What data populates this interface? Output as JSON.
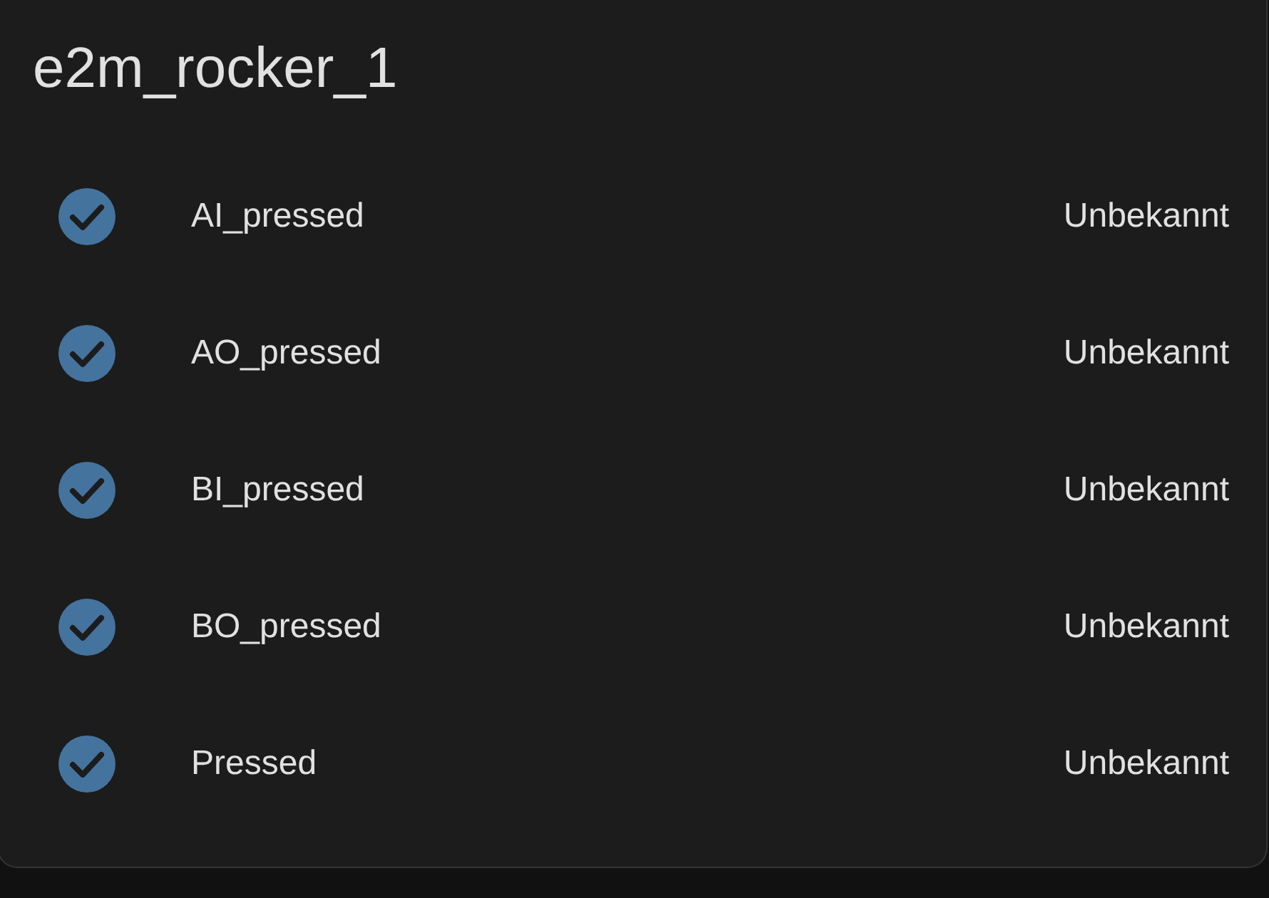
{
  "card": {
    "title": "e2m_rocker_1",
    "entities": [
      {
        "name": "AI_pressed",
        "state": "Unbekannt",
        "active": true
      },
      {
        "name": "AO_pressed",
        "state": "Unbekannt",
        "active": true
      },
      {
        "name": "BI_pressed",
        "state": "Unbekannt",
        "active": true
      },
      {
        "name": "BO_pressed",
        "state": "Unbekannt",
        "active": true
      },
      {
        "name": "Pressed",
        "state": "Unbekannt",
        "active": true
      }
    ]
  }
}
